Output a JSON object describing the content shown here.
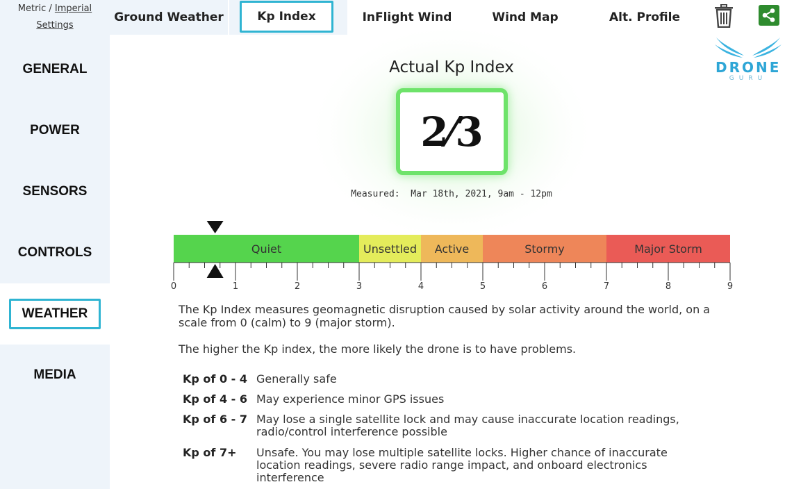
{
  "units": {
    "metric_label": "Metric",
    "separator": "/",
    "imperial_label": "Imperial",
    "settings_label": "Settings"
  },
  "sidebar": {
    "items": [
      {
        "label": "GENERAL"
      },
      {
        "label": "POWER"
      },
      {
        "label": "SENSORS"
      },
      {
        "label": "CONTROLS"
      },
      {
        "label": "WEATHER",
        "active": true
      },
      {
        "label": "MEDIA"
      }
    ]
  },
  "tabs": [
    {
      "label": "Ground Weather"
    },
    {
      "label": "Kp Index",
      "active": true
    },
    {
      "label": "InFlight Wind"
    },
    {
      "label": "Wind Map"
    },
    {
      "label": "Alt. Profile"
    }
  ],
  "icons": {
    "trash": "trash-icon",
    "share": "share-icon"
  },
  "logo": {
    "name": "DRONE",
    "sub": "GURU"
  },
  "main": {
    "title": "Actual Kp Index",
    "kp_value": "2⁄3",
    "measured_label": "Measured:",
    "measured_value": "Mar 18th, 2021, 9am - 12pm"
  },
  "scale": {
    "min": 0,
    "max": 9,
    "marker_value": 0.67,
    "ticks": [
      "0",
      "1",
      "2",
      "3",
      "4",
      "5",
      "6",
      "7",
      "8",
      "9"
    ],
    "zones": [
      {
        "label": "Quiet",
        "from": 0,
        "to": 3,
        "color": "#55d44d"
      },
      {
        "label": "Unsettled",
        "from": 3,
        "to": 4,
        "color": "#e4ec5b"
      },
      {
        "label": "Active",
        "from": 4,
        "to": 5,
        "color": "#eeb85a"
      },
      {
        "label": "Stormy",
        "from": 5,
        "to": 7,
        "color": "#ee8659"
      },
      {
        "label": "Major Storm",
        "from": 7,
        "to": 9,
        "color": "#ea5b56"
      }
    ]
  },
  "description": {
    "p1": "The Kp Index measures geomagnetic disruption caused by solar activity around the world, on a scale from 0 (calm) to 9 (major storm).",
    "p2": "The higher the Kp index, the more likely the drone is to have problems."
  },
  "rows": [
    {
      "k": "Kp of 0 - 4",
      "v": "Generally safe"
    },
    {
      "k": "Kp of 4 - 6",
      "v": "May experience minor GPS issues"
    },
    {
      "k": "Kp of 6 - 7",
      "v": "May lose a single satellite lock and may cause inaccurate location readings, radio/control interference possible"
    },
    {
      "k": "Kp of 7+",
      "v": "Unsafe. You may lose multiple satellite locks. Higher chance of inaccurate location readings, severe radio range impact, and onboard electronics interference"
    }
  ],
  "colors": {
    "accent": "#2fb4d2",
    "kp_box": "#6ee36a",
    "share": "#2e8b2e"
  }
}
